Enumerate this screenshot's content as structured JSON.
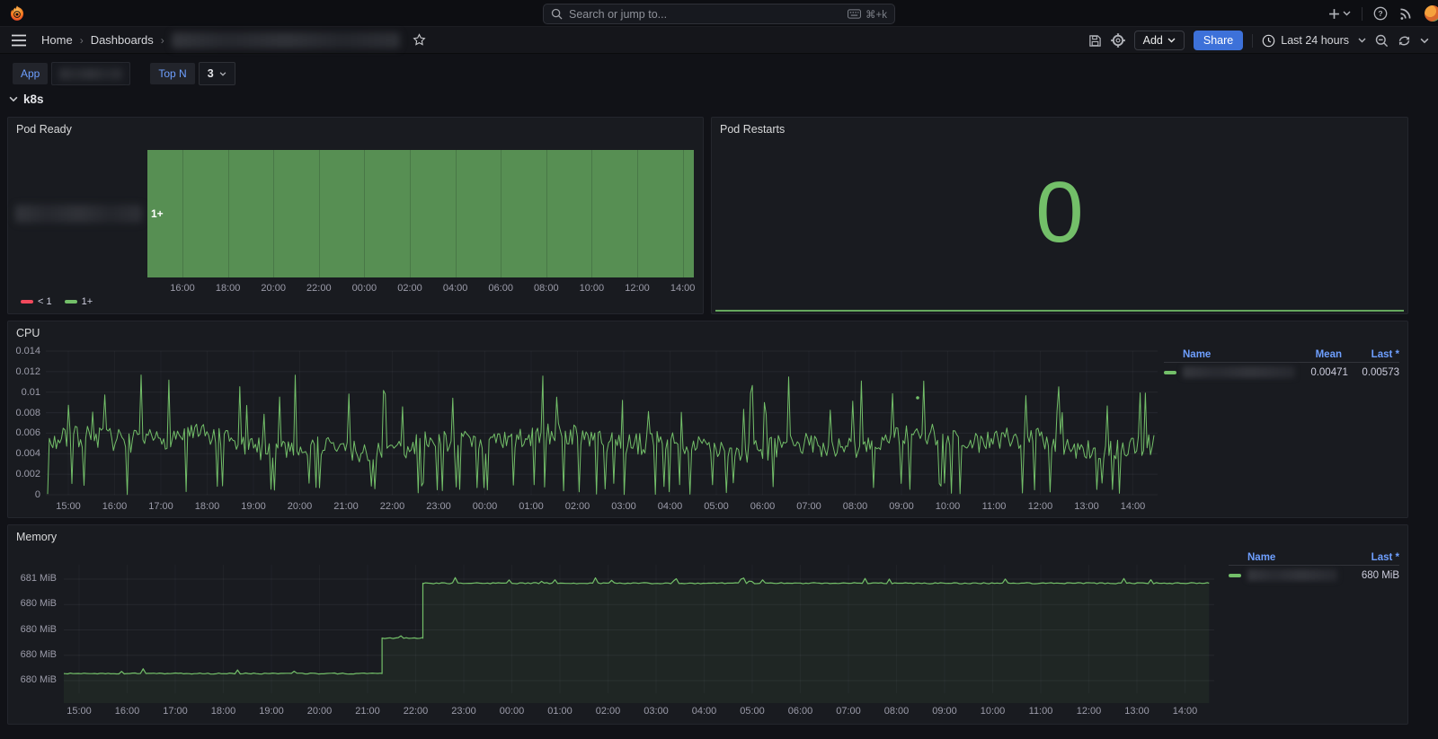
{
  "topnav": {
    "search_placeholder": "Search or jump to...",
    "search_shortcut": "⌘+k"
  },
  "breadcrumb": {
    "home": "Home",
    "dashboards": "Dashboards",
    "current_title_redacted": true
  },
  "toolbar": {
    "add_label": "Add",
    "share_label": "Share",
    "time_range": "Last 24 hours"
  },
  "filters": {
    "app_label": "App",
    "app_value_redacted": true,
    "topn_label": "Top N",
    "topn_value": "3"
  },
  "row": {
    "title": "k8s"
  },
  "colors": {
    "green_line": "#73bf69",
    "green_fill": "#578f53",
    "red": "#f2495c",
    "accent_blue": "#3d71d9",
    "link_blue": "#6e9fff"
  },
  "chart_data": [
    {
      "id": "pod_ready",
      "type": "state-timeline",
      "title": "Pod Ready",
      "value_label": "1+",
      "series": [
        {
          "name_redacted": true,
          "segments": [
            {
              "value": "1+",
              "covers": "entire 24h range",
              "color": "#578f53"
            }
          ]
        }
      ],
      "x_ticks": [
        "16:00",
        "18:00",
        "20:00",
        "22:00",
        "00:00",
        "02:00",
        "04:00",
        "06:00",
        "08:00",
        "10:00",
        "12:00",
        "14:00"
      ],
      "legend": [
        {
          "label": "< 1",
          "color": "#f2495c"
        },
        {
          "label": "1+",
          "color": "#73bf69"
        }
      ]
    },
    {
      "id": "pod_restarts",
      "type": "stat",
      "title": "Pod Restarts",
      "value": "0",
      "color": "#73bf69",
      "sparkline": "flat zero line along panel bottom"
    },
    {
      "id": "cpu",
      "type": "line",
      "title": "CPU",
      "ylim": [
        0,
        0.014
      ],
      "y_ticks": [
        "0.014",
        "0.012",
        "0.01",
        "0.008",
        "0.006",
        "0.004",
        "0.002",
        "0"
      ],
      "x_ticks": [
        "15:00",
        "16:00",
        "17:00",
        "18:00",
        "19:00",
        "20:00",
        "21:00",
        "22:00",
        "23:00",
        "00:00",
        "01:00",
        "02:00",
        "03:00",
        "04:00",
        "05:00",
        "06:00",
        "07:00",
        "08:00",
        "09:00",
        "10:00",
        "11:00",
        "12:00",
        "13:00",
        "14:00"
      ],
      "legend_columns": [
        "Name",
        "Mean",
        "Last *"
      ],
      "series": [
        {
          "name_redacted": true,
          "color": "#73bf69",
          "mean": "0.00471",
          "last": "0.00573",
          "pattern": "dense noise around 0.005 with frequent dips to 0 and spikes up to ~0.012",
          "noise": {
            "seed": 7,
            "points": 640,
            "base": 0.005,
            "dip_prob": 0.1,
            "spike_prob": 0.055,
            "spike_min": 0.0075,
            "spike_span": 0.0042
          }
        }
      ],
      "grid": true,
      "legend_position": "right-table"
    },
    {
      "id": "memory",
      "type": "line",
      "title": "Memory",
      "ylim_mib": [
        679.95,
        681.2
      ],
      "y_ticks": [
        "681 MiB",
        "680 MiB",
        "680 MiB",
        "680 MiB",
        "680 MiB"
      ],
      "x_ticks": [
        "15:00",
        "16:00",
        "17:00",
        "18:00",
        "19:00",
        "20:00",
        "21:00",
        "22:00",
        "23:00",
        "00:00",
        "01:00",
        "02:00",
        "03:00",
        "04:00",
        "05:00",
        "06:00",
        "07:00",
        "08:00",
        "09:00",
        "10:00",
        "11:00",
        "12:00",
        "13:00",
        "14:00"
      ],
      "legend_columns": [
        "Name",
        "Last *"
      ],
      "series": [
        {
          "name_redacted": true,
          "color": "#73bf69",
          "last": "680 MiB",
          "steps_mib": [
            [
              -0.35,
              680.07
            ],
            [
              6.3,
              680.07
            ],
            [
              6.3,
              680.42
            ],
            [
              7.15,
              680.42
            ],
            [
              7.15,
              680.96
            ],
            [
              23.5,
              680.96
            ]
          ],
          "noise": {
            "seed": 11,
            "bump_prob": 0.05,
            "bump_mib": 0.05
          }
        }
      ],
      "grid": true,
      "legend_position": "right-table"
    }
  ]
}
